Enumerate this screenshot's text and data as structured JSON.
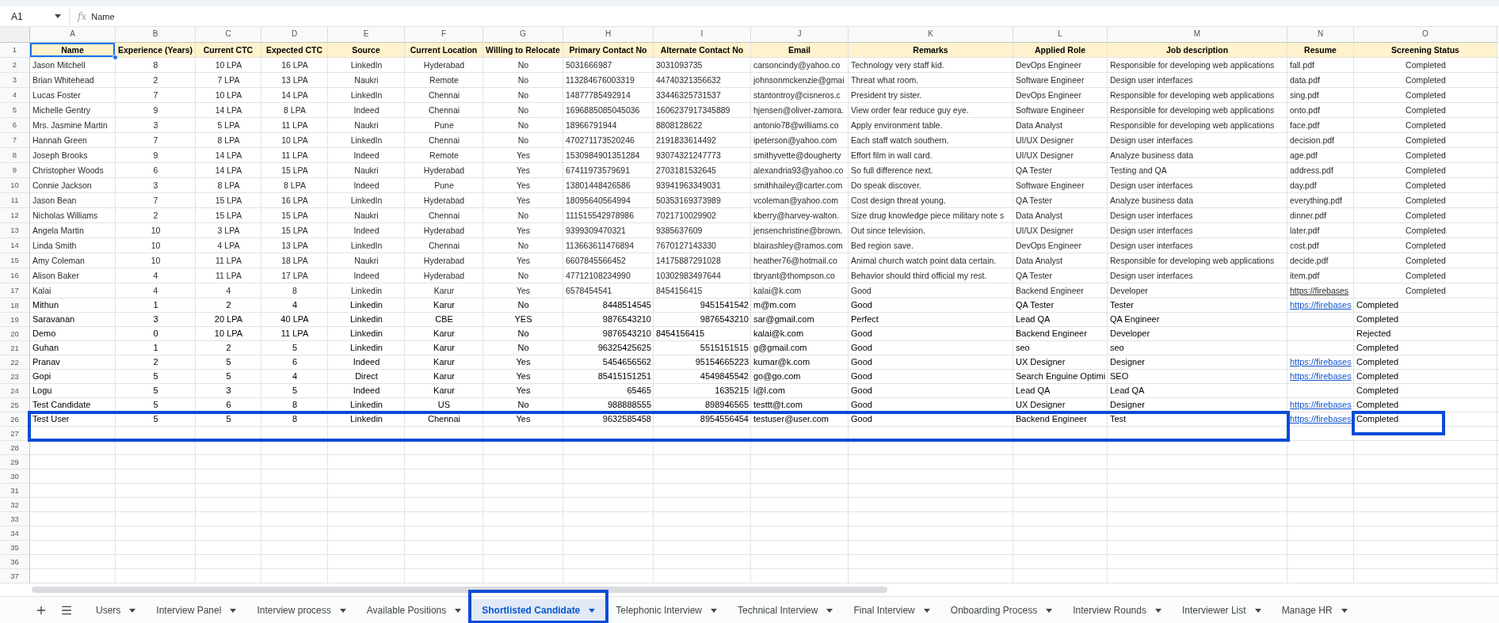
{
  "formula_bar": {
    "cell_ref": "A1",
    "fx_label": "fx",
    "formula": "Name"
  },
  "header_row": {
    "number": "1"
  },
  "columns": [
    {
      "letter": "A",
      "header": "Name",
      "selected": true
    },
    {
      "letter": "B",
      "header": "Experience (Years)",
      "selected": false
    },
    {
      "letter": "C",
      "header": "Current CTC",
      "selected": false
    },
    {
      "letter": "D",
      "header": "Expected CTC",
      "selected": false
    },
    {
      "letter": "E",
      "header": "Source",
      "selected": false
    },
    {
      "letter": "F",
      "header": "Current Location",
      "selected": false
    },
    {
      "letter": "G",
      "header": "Willing to Relocate",
      "selected": false
    },
    {
      "letter": "H",
      "header": "Primary Contact No",
      "selected": false
    },
    {
      "letter": "I",
      "header": "Alternate Contact No",
      "selected": false
    },
    {
      "letter": "J",
      "header": "Email",
      "selected": false
    },
    {
      "letter": "K",
      "header": "Remarks",
      "selected": false
    },
    {
      "letter": "L",
      "header": "Applied Role",
      "selected": false
    },
    {
      "letter": "M",
      "header": "Job description",
      "selected": false
    },
    {
      "letter": "N",
      "header": "Resume",
      "selected": false
    },
    {
      "letter": "O",
      "header": "Screening Status",
      "selected": false
    }
  ],
  "rows": [
    {
      "number": "2",
      "kind": "formatted",
      "highlighted": false,
      "cells": [
        "Jason Mitchell",
        "8",
        "10 LPA",
        "16 LPA",
        "LinkedIn",
        "Hyderabad",
        "No",
        "5031666987",
        "3031093735",
        "carsoncindy@yahoo.co",
        "Technology very staff kid.",
        "DevOps Engineer",
        "Responsible for developing web applications",
        "fall.pdf",
        "Completed"
      ]
    },
    {
      "number": "3",
      "kind": "formatted",
      "highlighted": false,
      "cells": [
        "Brian Whitehead",
        "2",
        "7 LPA",
        "13 LPA",
        "Naukri",
        "Remote",
        "No",
        "113284676003319",
        "44740321356632",
        "johnsonmckenzie@gmai",
        "Threat what room.",
        "Software Engineer",
        "Design user interfaces",
        "data.pdf",
        "Completed"
      ]
    },
    {
      "number": "4",
      "kind": "formatted",
      "highlighted": false,
      "cells": [
        "Lucas Foster",
        "7",
        "10 LPA",
        "14 LPA",
        "LinkedIn",
        "Chennai",
        "No",
        "14877785492914",
        "33446325731537",
        "stantontroy@cisneros.c",
        "President try sister.",
        "DevOps Engineer",
        "Responsible for developing web applications",
        "sing.pdf",
        "Completed"
      ]
    },
    {
      "number": "5",
      "kind": "formatted",
      "highlighted": false,
      "cells": [
        "Michelle Gentry",
        "9",
        "14 LPA",
        "8 LPA",
        "Indeed",
        "Chennai",
        "No",
        "1696885085045036",
        "1606237917345889",
        "hjensen@oliver-zamora.",
        "View order fear reduce guy eye.",
        "Software Engineer",
        "Responsible for developing web applications",
        "onto.pdf",
        "Completed"
      ]
    },
    {
      "number": "6",
      "kind": "formatted",
      "highlighted": false,
      "cells": [
        "Mrs. Jasmine Martin",
        "3",
        "5 LPA",
        "11 LPA",
        "Naukri",
        "Pune",
        "No",
        "18966791944",
        "8808128622",
        "antonio78@williams.co",
        "Apply environment table.",
        "Data Analyst",
        "Responsible for developing web applications",
        "face.pdf",
        "Completed"
      ]
    },
    {
      "number": "7",
      "kind": "formatted",
      "highlighted": false,
      "cells": [
        "Hannah Green",
        "7",
        "8 LPA",
        "10 LPA",
        "LinkedIn",
        "Chennai",
        "No",
        "470271173520246",
        "2191833614492",
        "ipeterson@yahoo.com",
        "Each staff watch southern.",
        "UI/UX Designer",
        "Design user interfaces",
        "decision.pdf",
        "Completed"
      ]
    },
    {
      "number": "8",
      "kind": "formatted",
      "highlighted": false,
      "cells": [
        "Joseph Brooks",
        "9",
        "14 LPA",
        "11 LPA",
        "Indeed",
        "Remote",
        "Yes",
        "1530984901351284",
        "93074321247773",
        "smithyvette@dougherty",
        "Effort film in wall card.",
        "UI/UX Designer",
        "Analyze business data",
        "age.pdf",
        "Completed"
      ]
    },
    {
      "number": "9",
      "kind": "formatted",
      "highlighted": false,
      "cells": [
        "Christopher Woods",
        "6",
        "14 LPA",
        "15 LPA",
        "Naukri",
        "Hyderabad",
        "Yes",
        "67411973579691",
        "2703181532645",
        "alexandria93@yahoo.co",
        "So full difference next.",
        "QA Tester",
        "Testing and QA",
        "address.pdf",
        "Completed"
      ]
    },
    {
      "number": "10",
      "kind": "formatted",
      "highlighted": false,
      "cells": [
        "Connie Jackson",
        "3",
        "8 LPA",
        "8 LPA",
        "Indeed",
        "Pune",
        "Yes",
        "13801448426586",
        "93941963349031",
        "smithhailey@carter.com",
        "Do speak discover.",
        "Software Engineer",
        "Design user interfaces",
        "day.pdf",
        "Completed"
      ]
    },
    {
      "number": "11",
      "kind": "formatted",
      "highlighted": false,
      "cells": [
        "Jason Bean",
        "7",
        "15 LPA",
        "16 LPA",
        "LinkedIn",
        "Hyderabad",
        "Yes",
        "18095640564994",
        "50353169373989",
        "vcoleman@yahoo.com",
        "Cost design threat young.",
        "QA Tester",
        "Analyze business data",
        "everything.pdf",
        "Completed"
      ]
    },
    {
      "number": "12",
      "kind": "formatted",
      "highlighted": false,
      "cells": [
        "Nicholas Williams",
        "2",
        "15 LPA",
        "15 LPA",
        "Naukri",
        "Chennai",
        "No",
        "111515542978986",
        "7021710029902",
        "kberry@harvey-walton.",
        "Size drug knowledge piece military note s",
        "Data Analyst",
        "Design user interfaces",
        "dinner.pdf",
        "Completed"
      ]
    },
    {
      "number": "13",
      "kind": "formatted",
      "highlighted": false,
      "cells": [
        "Angela Martin",
        "10",
        "3 LPA",
        "15 LPA",
        "Indeed",
        "Hyderabad",
        "Yes",
        "9399309470321",
        "9385637609",
        "jensenchristine@brown.",
        "Out since television.",
        "UI/UX Designer",
        "Design user interfaces",
        "later.pdf",
        "Completed"
      ]
    },
    {
      "number": "14",
      "kind": "formatted",
      "highlighted": false,
      "cells": [
        "Linda Smith",
        "10",
        "4 LPA",
        "13 LPA",
        "LinkedIn",
        "Chennai",
        "No",
        "113663611476894",
        "7670127143330",
        "blairashley@ramos.com",
        "Bed region save.",
        "DevOps Engineer",
        "Design user interfaces",
        "cost.pdf",
        "Completed"
      ]
    },
    {
      "number": "15",
      "kind": "formatted",
      "highlighted": false,
      "cells": [
        "Amy Coleman",
        "10",
        "11 LPA",
        "18 LPA",
        "Naukri",
        "Hyderabad",
        "Yes",
        "6607845566452",
        "14175887291028",
        "heather76@hotmail.co",
        "Animal church watch point data certain.",
        "Data Analyst",
        "Responsible for developing web applications",
        "decide.pdf",
        "Completed"
      ]
    },
    {
      "number": "16",
      "kind": "formatted",
      "highlighted": false,
      "cells": [
        "Alison Baker",
        "4",
        "11 LPA",
        "17 LPA",
        "Indeed",
        "Hyderabad",
        "No",
        "47712108234990",
        "10302983497644",
        "tbryant@thompson.co",
        "Behavior should third official my rest.",
        "QA Tester",
        "Design user interfaces",
        "item.pdf",
        "Completed"
      ]
    },
    {
      "number": "17",
      "kind": "formatted",
      "highlighted": false,
      "cells": [
        "Kalai",
        "4",
        "4",
        "8",
        "Linkedin",
        "Karur",
        "Yes",
        "6578454541",
        "8454156415",
        "kalai@k.com",
        "Good",
        "Backend Engineer",
        "Developer",
        {
          "text": "https://firebases",
          "kind": "underline"
        },
        "Completed"
      ]
    },
    {
      "number": "18",
      "kind": "raw",
      "highlighted": false,
      "cells": [
        "Mithun",
        "1",
        "2",
        "4",
        "Linkedin",
        "Karur",
        "No",
        {
          "text": "8448514545",
          "kind": "number"
        },
        {
          "text": "9451541542",
          "kind": "number"
        },
        "m@m.com",
        "Good",
        "QA Tester",
        "Tester",
        {
          "text": "https://firebases",
          "kind": "link"
        },
        "Completed"
      ]
    },
    {
      "number": "19",
      "kind": "raw",
      "highlighted": false,
      "cells": [
        "Saravanan",
        "3",
        "20 LPA",
        "40 LPA",
        "Linkedin",
        "CBE",
        "YES",
        {
          "text": "9876543210",
          "kind": "number"
        },
        {
          "text": "9876543210",
          "kind": "number"
        },
        "sar@gmail.com",
        "Perfect",
        "Lead QA",
        "QA Engineer",
        null,
        "Completed"
      ]
    },
    {
      "number": "20",
      "kind": "raw",
      "highlighted": false,
      "cells": [
        "Demo",
        "0",
        "10 LPA",
        "11 LPA",
        "Linkedin",
        "Karur",
        "No",
        {
          "text": "9876543210",
          "kind": "number"
        },
        "8454156415",
        "kalai@k.com",
        "Good",
        "Backend Engineer",
        "Developer",
        null,
        "Rejected"
      ]
    },
    {
      "number": "21",
      "kind": "raw",
      "highlighted": false,
      "cells": [
        "Guhan",
        "1",
        "2",
        "5",
        "Linkedin",
        "Karur",
        "No",
        {
          "text": "96325425625",
          "kind": "number"
        },
        {
          "text": "5515151515",
          "kind": "number"
        },
        "g@gmail.com",
        "Good",
        "seo",
        "seo",
        null,
        "Completed"
      ]
    },
    {
      "number": "22",
      "kind": "raw",
      "highlighted": false,
      "cells": [
        "Pranav",
        "2",
        "5",
        "6",
        "Indeed",
        "Karur",
        "Yes",
        {
          "text": "5454656562",
          "kind": "number"
        },
        {
          "text": "95154665223",
          "kind": "number"
        },
        "kumar@k.com",
        "Good",
        "UX Designer",
        "Designer",
        {
          "text": "https://firebases",
          "kind": "link"
        },
        "Completed"
      ]
    },
    {
      "number": "23",
      "kind": "raw",
      "highlighted": false,
      "cells": [
        "Gopi",
        "5",
        "5",
        "4",
        "Direct",
        "Karur",
        "Yes",
        {
          "text": "85415151251",
          "kind": "number"
        },
        {
          "text": "4549845542",
          "kind": "number"
        },
        "go@go.com",
        "Good",
        "Search Enguine Optimi",
        "SEO",
        {
          "text": "https://firebases",
          "kind": "link"
        },
        "Completed"
      ]
    },
    {
      "number": "24",
      "kind": "raw",
      "highlighted": false,
      "cells": [
        "Logu",
        "5",
        "3",
        "5",
        "Indeed",
        "Karur",
        "Yes",
        {
          "text": "65465",
          "kind": "number"
        },
        {
          "text": "1635215",
          "kind": "number"
        },
        "l@l.com",
        "Good",
        "Lead QA",
        "Lead QA",
        null,
        "Completed"
      ]
    },
    {
      "number": "25",
      "kind": "raw",
      "highlighted": false,
      "cells": [
        "Test Candidate",
        "5",
        "6",
        "8",
        "Linkedin",
        "US",
        "No",
        {
          "text": "988888555",
          "kind": "number"
        },
        {
          "text": "898946565",
          "kind": "number"
        },
        "testtt@t.com",
        "Good",
        "UX Designer",
        "Designer",
        {
          "text": "https://firebases",
          "kind": "link"
        },
        "Completed"
      ]
    },
    {
      "number": "26",
      "kind": "raw",
      "highlighted": true,
      "cells": [
        "Test User",
        "5",
        "5",
        "8",
        "Linkedin",
        "Chennai",
        "Yes",
        {
          "text": "9632585458",
          "kind": "number"
        },
        {
          "text": "8954556454",
          "kind": "number"
        },
        "testuser@user.com",
        "Good",
        "Backend Engineer",
        "Test",
        {
          "text": "https://firebases",
          "kind": "link"
        },
        "Completed"
      ]
    }
  ],
  "empty_rows": [
    "27",
    "28",
    "29",
    "30",
    "31",
    "32",
    "33",
    "34",
    "35",
    "36",
    "37"
  ],
  "sheet_tabs": [
    {
      "label": "Users",
      "selected": false,
      "highlighted": false
    },
    {
      "label": "Interview Panel",
      "selected": false,
      "highlighted": false
    },
    {
      "label": "Interview process",
      "selected": false,
      "highlighted": false
    },
    {
      "label": "Available Positions",
      "selected": false,
      "highlighted": false
    },
    {
      "label": "Shortlisted Candidate",
      "selected": true,
      "highlighted": true
    },
    {
      "label": "Telephonic Interview",
      "selected": false,
      "highlighted": false
    },
    {
      "label": "Technical Interview",
      "selected": false,
      "highlighted": false
    },
    {
      "label": "Final Interview",
      "selected": false,
      "highlighted": false
    },
    {
      "label": "Onboarding Process",
      "selected": false,
      "highlighted": false
    },
    {
      "label": "Interview Rounds",
      "selected": false,
      "highlighted": false
    },
    {
      "label": "Interviewer List",
      "selected": false,
      "highlighted": false
    },
    {
      "label": "Manage HR",
      "selected": false,
      "highlighted": false
    }
  ]
}
